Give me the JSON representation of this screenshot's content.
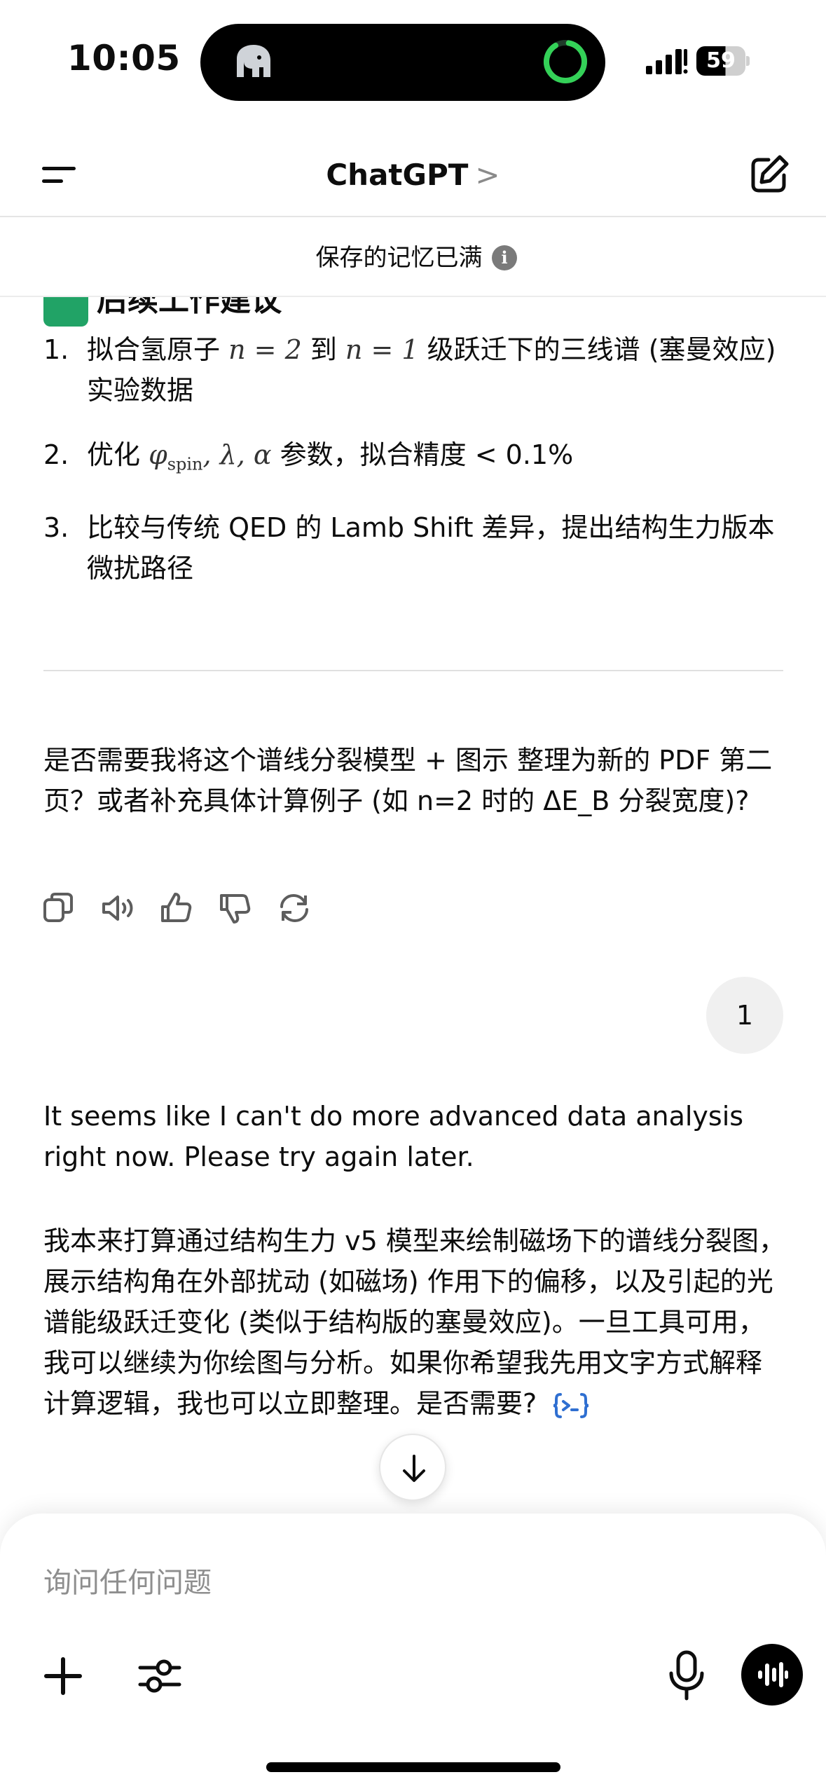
{
  "status_bar": {
    "time": "10:05",
    "battery": "59",
    "battery_level": 0.59
  },
  "nav": {
    "title": "ChatGPT",
    "title_chevron": ">"
  },
  "memory_banner": {
    "text": "保存的记忆已满",
    "info_glyph": "i"
  },
  "assistant_message_1": {
    "heading_partial": "后续工作建议",
    "list": [
      {
        "num": "1.",
        "text_a": "拟合氢原子 ",
        "math_a": "n = 2",
        "text_b": " 到 ",
        "math_b": "n = 1",
        "text_c": " 级跃迁下的三线谱 (塞曼效应) 实验数据"
      },
      {
        "num": "2.",
        "text_a": "优化 ",
        "math_phi": "φ",
        "math_sub": "spin",
        "math_rest": ", λ, α",
        "text_b": " 参数，拟合精度 < 0.1%"
      },
      {
        "num": "3.",
        "text": "比较与传统 QED 的 Lamb Shift 差异，提出结构生力版本微扰路径"
      }
    ],
    "question": "是否需要我将这个谱线分裂模型 + 图示 整理为新的 PDF 第二页？或者补充具体计算例子 (如 n=2 时的 ΔE_B 分裂宽度)?",
    "actions": [
      "copy-icon",
      "speaker-icon",
      "thumbs-up-icon",
      "thumbs-down-icon",
      "regenerate-icon"
    ]
  },
  "user_message": {
    "text": "1"
  },
  "assistant_message_2": {
    "para_1": "It seems like I can't do more advanced data analysis right now. Please try again later.",
    "para_2": "我本来打算通过结构生力 v5 模型来绘制磁场下的谱线分裂图，展示结构角在外部扰动 (如磁场) 作用下的偏移，以及引起的光谱能级跃迁变化 (类似于结构版的塞曼效应)。一旦工具可用，我可以继续为你绘图与分析。如果你希望我先用文字方式解释计算逻辑，我也可以立即整理。是否需要?",
    "cite_icon": "code-interpreter-icon"
  },
  "composer": {
    "placeholder": "询问任何问题"
  },
  "colors": {
    "accent_green": "#21a366",
    "ring_green": "#34d158",
    "cite_blue": "#2f6fd1",
    "text": "#0d0d0d",
    "muted": "#8e8e8e"
  }
}
